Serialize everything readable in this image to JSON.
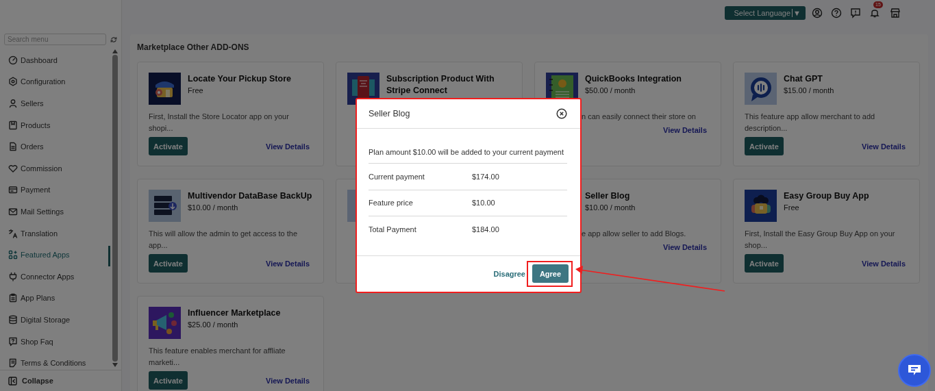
{
  "header": {
    "language_button": "Select Language",
    "language_caret": "▼",
    "notification_count": "15"
  },
  "sidebar": {
    "search": {
      "placeholder": "Search menu"
    },
    "items": [
      {
        "label": "Dashboard",
        "selected": false
      },
      {
        "label": "Configuration",
        "selected": false
      },
      {
        "label": "Sellers",
        "selected": false
      },
      {
        "label": "Products",
        "selected": false
      },
      {
        "label": "Orders",
        "selected": false
      },
      {
        "label": "Commission",
        "selected": false
      },
      {
        "label": "Payment",
        "selected": false
      },
      {
        "label": "Mail Settings",
        "selected": false
      },
      {
        "label": "Translation",
        "selected": false
      },
      {
        "label": "Featured Apps",
        "selected": true
      },
      {
        "label": "Connector Apps",
        "selected": false
      },
      {
        "label": "App Plans",
        "selected": false
      },
      {
        "label": "Digital Storage",
        "selected": false
      },
      {
        "label": "Shop Faq",
        "selected": false
      },
      {
        "label": "Terms & Conditions",
        "selected": false
      }
    ],
    "collapse": "Collapse"
  },
  "section": {
    "title": "Marketplace Other ADD-ONS",
    "cards": [
      {
        "kind": "app",
        "title": "Locate Your Pickup Store",
        "price": "Free",
        "description": "First, Install the Store Locator app on your shopi...",
        "activate": "Activate",
        "details": "View Details",
        "covered": false
      },
      {
        "kind": "app",
        "title": "Subscription Product With Stripe Connect"
      },
      {
        "kind": "app",
        "title": "QuickBooks Integration",
        "price": "$50.00 / month",
        "description": "n can easily connect their store on",
        "details": "View Details",
        "covered": true
      },
      {
        "kind": "app",
        "title": "Chat GPT",
        "price": "$15.00 / month",
        "description": "This feature app allow merchant to add description...",
        "activate": "Activate",
        "details": "View Details",
        "covered": false
      },
      {
        "kind": "app",
        "title": "Multivendor DataBase BackUp",
        "price": "$10.00 / month",
        "description": "This will allow the admin to get access to the app...",
        "activate": "Activate",
        "details": "View Details",
        "covered": false
      },
      {
        "kind": "blank"
      },
      {
        "kind": "app",
        "title": "Seller Blog",
        "price": "$10.00 / month",
        "description": "e app allow seller to add Blogs.",
        "details": "View Details",
        "covered": true
      },
      {
        "kind": "app",
        "title": "Easy Group Buy App",
        "price": "Free",
        "description": "First, Install the Easy Group Buy App on your shop...",
        "activate": "Activate",
        "details": "View Details",
        "covered": false
      },
      {
        "kind": "app",
        "title": "Influencer Marketplace",
        "price": "$25.00 / month",
        "description": "This feature enables merchant for affliate marketi...",
        "activate": "Activate",
        "details": "View Details",
        "covered": false
      }
    ]
  },
  "dialog": {
    "title": "Seller Blog",
    "message": "Plan amount $10.00 will be added to your current payment",
    "rows": [
      {
        "label": "Current payment",
        "value": "$174.00"
      },
      {
        "label": "Feature price",
        "value": "$10.00"
      },
      {
        "label": "Total Payment",
        "value": "$184.00"
      }
    ],
    "disagree": "Disagree",
    "agree": "Agree"
  }
}
